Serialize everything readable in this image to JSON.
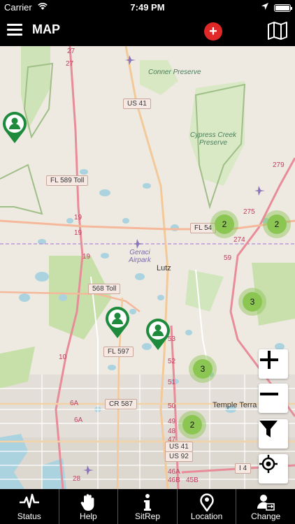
{
  "status_bar": {
    "carrier": "Carrier",
    "time": "7:49 PM"
  },
  "header": {
    "title": "MAP",
    "add_icon": "plus-icon",
    "map_icon": "folded-map-icon",
    "add_color": "#e02828"
  },
  "map": {
    "places": {
      "conner_preserve": "Conner Preserve",
      "cypress_creek": "Cypress Creek Preserve",
      "geraci": "Geraci Airpark",
      "lutz": "Lutz",
      "temple_terrace": "Temple Terra"
    },
    "road_labels": {
      "us41_top": "US 41",
      "fl589": "FL 589 Toll",
      "fl54": "FL 54",
      "toll568": "568 Toll",
      "fl597": "FL 597",
      "cr587": "CR 587",
      "us41_bottom": "US 41",
      "us92": "US 92",
      "i4": "I 4",
      "r27a": "27",
      "r27b": "27",
      "r19a": "19",
      "r19b": "19",
      "r19c": "19",
      "r275": "275",
      "r279": "279",
      "r274": "274",
      "r59": "59",
      "r53": "53",
      "r52": "52",
      "r51": "51",
      "r50": "50",
      "r49": "49",
      "r48": "48",
      "r47": "47",
      "r46a": "46A",
      "r46b": "46B",
      "r45b": "45B",
      "r6a": "6A",
      "r6b": "6A",
      "r28": "28",
      "r10": "10"
    },
    "clusters": [
      {
        "count": "2"
      },
      {
        "count": "2"
      },
      {
        "count": "3"
      },
      {
        "count": "3"
      },
      {
        "count": "2"
      }
    ],
    "pin_color": "#1e8a3c",
    "cluster_color": "#8cc652"
  },
  "controls": {
    "zoom_in": "plus-icon",
    "zoom_out": "minus-icon",
    "filter": "filter-icon",
    "locate": "crosshair-icon"
  },
  "tabs": [
    {
      "label": "Status",
      "icon": "pulse-icon"
    },
    {
      "label": "Help",
      "icon": "hand-icon"
    },
    {
      "label": "SitRep",
      "icon": "info-icon"
    },
    {
      "label": "Location",
      "icon": "location-pin-icon"
    },
    {
      "label": "Change",
      "icon": "user-change-icon"
    }
  ]
}
